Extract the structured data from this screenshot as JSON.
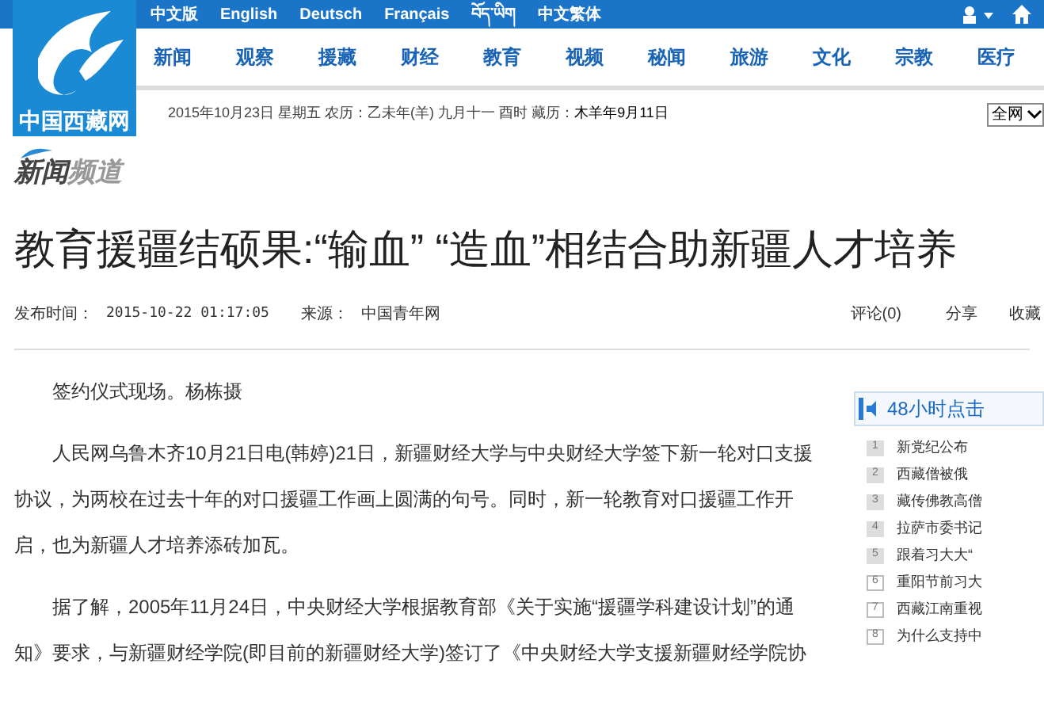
{
  "logo": {
    "text": "中国西藏网"
  },
  "languages": [
    "中文版",
    "English",
    "Deutsch",
    "Français",
    "བོད་ཡིག",
    "中文繁体"
  ],
  "nav": [
    "新闻",
    "观察",
    "援藏",
    "财经",
    "教育",
    "视频",
    "秘闻",
    "旅游",
    "文化",
    "宗教",
    "医疗"
  ],
  "date_line": {
    "date": "2015年10月23日 星期五 农历：乙未年(羊) 九月十一 酉时",
    "tibetan_calendar_label": "藏历：",
    "tibetan_calendar": "木羊年9月11日"
  },
  "search_scope": {
    "value": "全网"
  },
  "channel": {
    "title_a": "新闻",
    "title_b": "频道"
  },
  "article": {
    "title": "教育援疆结硕果:“输血” “造血”相结合助新疆人才培养",
    "published_label": "发布时间：",
    "published": "2015-10-22 01:17:05",
    "source_label": "来源：",
    "source": "中国青年网",
    "comments": "评论(0)",
    "share": "分享",
    "favorite": "收藏",
    "paragraphs": [
      "签约仪式现场。杨栋摄",
      "人民网乌鲁木齐10月21日电(韩婷)21日，新疆财经大学与中央财经大学签下新一轮对口支援协议，为两校在过去十年的对口援疆工作画上圆满的句号。同时，新一轮教育对口援疆工作开启，也为新疆人才培养添砖加瓦。",
      "据了解，2005年11月24日，中央财经大学根据教育部《关于实施“援疆学科建设计划”的通知》要求，与新疆财经学院(即目前的新疆财经大学)签订了《中央财经大学支援新疆财经学院协"
    ]
  },
  "sidebar": {
    "title": "48小时点击",
    "items": [
      {
        "rank": "1",
        "kind": "top",
        "text": "新党纪公布"
      },
      {
        "rank": "2",
        "kind": "top",
        "text": "西藏僧被俄"
      },
      {
        "rank": "3",
        "kind": "top",
        "text": "藏传佛教高僧"
      },
      {
        "rank": "4",
        "kind": "top",
        "text": "拉萨市委书记"
      },
      {
        "rank": "5",
        "kind": "top",
        "text": "跟着习大大“"
      },
      {
        "rank": "6",
        "kind": "normal",
        "text": "重阳节前习大"
      },
      {
        "rank": "7",
        "kind": "normal",
        "text": "西藏江南重视"
      },
      {
        "rank": "8",
        "kind": "normal",
        "text": "为什么支持中"
      }
    ]
  }
}
